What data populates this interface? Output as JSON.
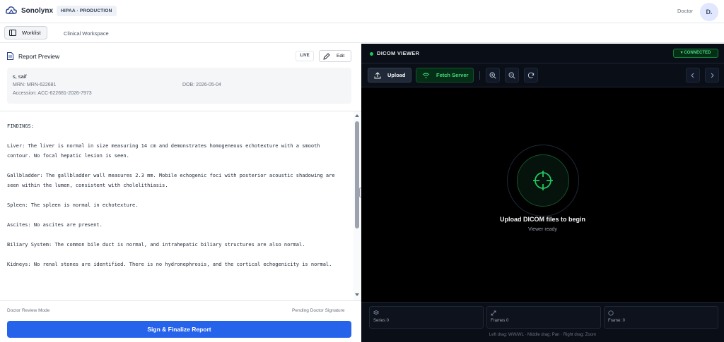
{
  "header": {
    "brand": "Sonolynx",
    "env_badge": "HIPAA · PRODUCTION",
    "user_role": "Doctor",
    "avatar_initial": "D."
  },
  "nav": {
    "tabs": [
      {
        "label": "Worklist",
        "active": true
      },
      {
        "label": "Clinical Workspace",
        "active": false
      }
    ]
  },
  "report": {
    "title": "Report Preview",
    "live_label": "LIVE",
    "edit_label": "Edit",
    "patient": {
      "name": "s, saif",
      "mrn": "MRN: MRN-622681",
      "dob": "DOB: 2026-05-04",
      "accession": "Accession: ACC-622681-2026-7973"
    },
    "paragraphs": [
      "FINDINGS:",
      "Liver: The liver is normal in size measuring 14 cm and demonstrates homogeneous echotexture with a smooth contour. No focal hepatic lesion is seen.",
      "Gallbladder: The gallbladder wall measures 2.3 mm. Mobile echogenic foci with posterior acoustic shadowing are seen within the lumen, consistent with cholelithiasis.",
      "Spleen: The spleen is normal in echotexture.",
      "Ascites: No ascites are present.",
      "Biliary System: The common bile duct is normal, and intrahepatic biliary structures are also normal.",
      "Kidneys: No renal stones are identified. There is no hydronephrosis, and the cortical echogenicity is normal."
    ],
    "mode": "Doctor Review Mode",
    "signature_status": "Pending Doctor Signature",
    "sign_button": "Sign & Finalize Report"
  },
  "viewer": {
    "title": "DICOM VIEWER",
    "status": "CONNECTED",
    "upload_label": "Upload",
    "fetch_label": "Fetch Server",
    "empty_title": "Upload DICOM files to begin",
    "empty_sub": "Viewer ready",
    "stats": {
      "series": "Series 0",
      "frames": "Frames 0",
      "frame": "Frame: 0"
    },
    "hint": "Left drag: WW/WL · Middle drag: Pan · Right drag: Zoom"
  },
  "colors": {
    "primary": "#2563eb",
    "viewer_bg": "#000000",
    "success": "#4ade80"
  }
}
